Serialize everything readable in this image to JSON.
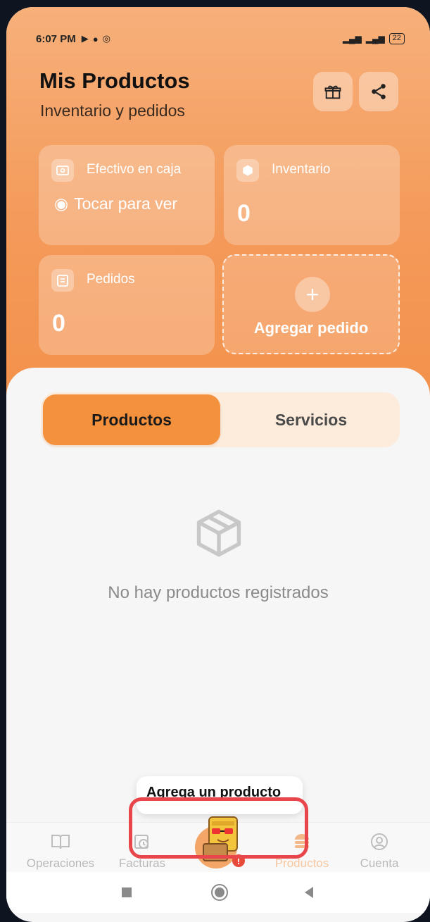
{
  "status_bar": {
    "time": "6:07 PM",
    "battery": "22"
  },
  "header": {
    "title": "Mis Productos",
    "subtitle": "Inventario y pedidos",
    "buttons": [
      {
        "icon": "gift-box-icon"
      },
      {
        "icon": "share-icon"
      }
    ]
  },
  "cards": {
    "efectivo": {
      "label": "Efectivo en caja",
      "hint": "Tocar para ver"
    },
    "inventario": {
      "label": "Inventario",
      "value": "0"
    },
    "pedidos": {
      "label": "Pedidos",
      "value": "0"
    },
    "agregar": {
      "label": "Agregar pedido",
      "icon": "plus-icon"
    }
  },
  "segmented": {
    "tabs": [
      {
        "label": "Productos",
        "active": true
      },
      {
        "label": "Servicios",
        "active": false
      }
    ]
  },
  "empty_state": {
    "icon": "box-icon",
    "text": "No hay productos registrados"
  },
  "tooltip": {
    "text": "Agrega un producto"
  },
  "bottom_nav": {
    "items": [
      {
        "label": "Operaciones",
        "icon": "book-icon"
      },
      {
        "label": "Facturas",
        "icon": "calendar-clock-icon"
      },
      {
        "label": "Productos",
        "icon": "stack-icon",
        "active": true
      },
      {
        "label": "Cuenta",
        "icon": "user-circle-icon"
      }
    ]
  },
  "colors": {
    "accent": "#f4913c",
    "highlight": "#e8464b",
    "tab_bg": "#fdebdb"
  }
}
